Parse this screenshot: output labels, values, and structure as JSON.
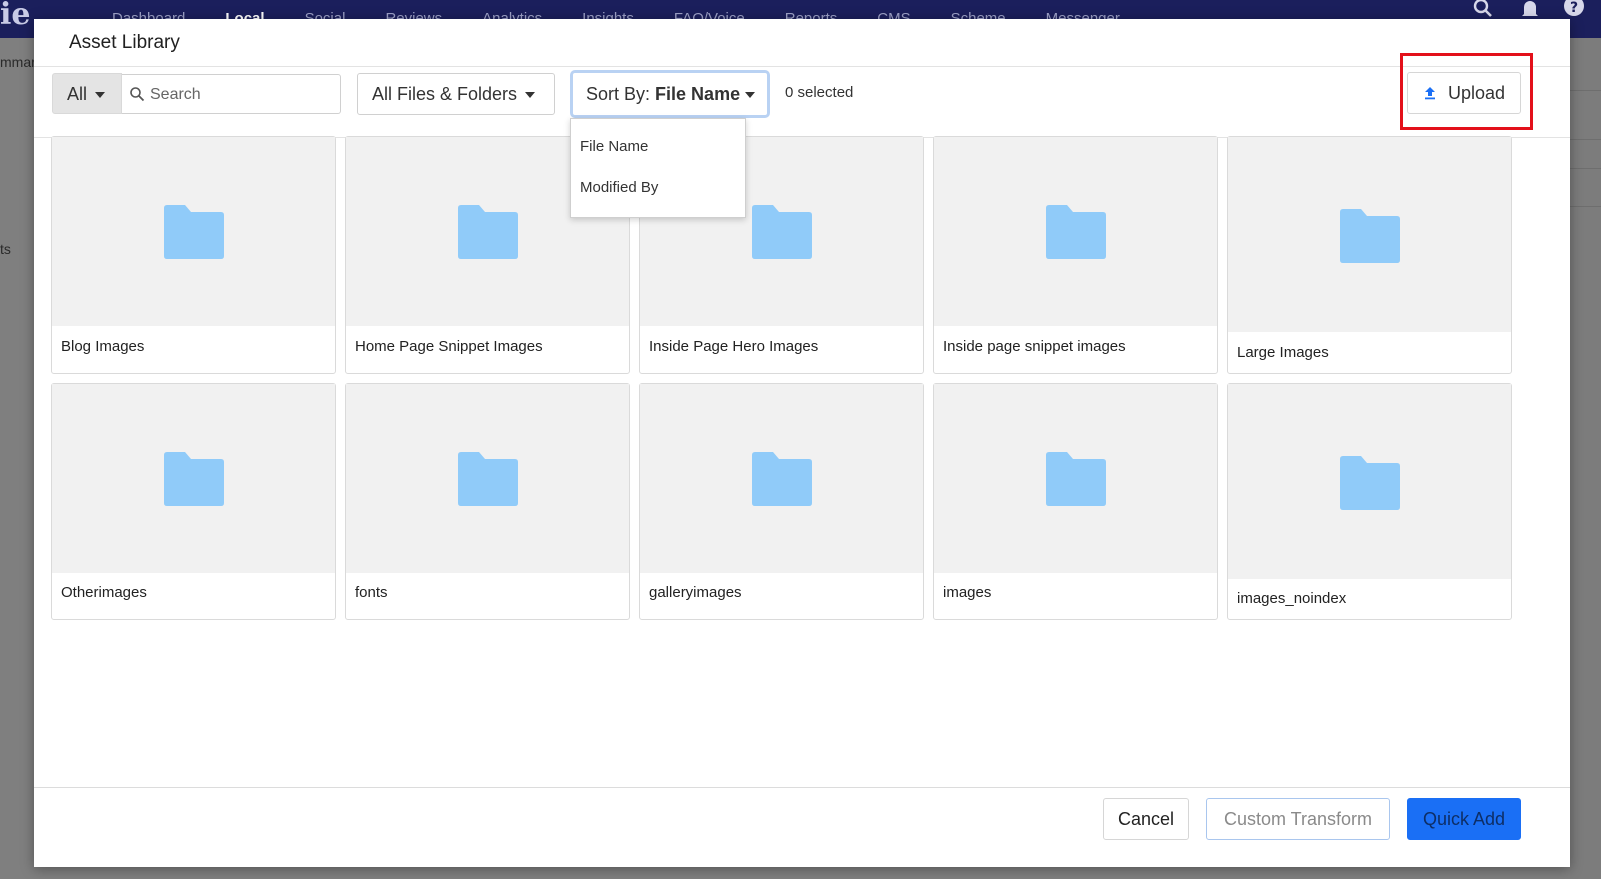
{
  "background": {
    "logo": "ie",
    "nav": [
      "Dashboard",
      "Local",
      "Social",
      "Reviews",
      "Analytics",
      "Insights",
      "FAQ/Voice",
      "Reports",
      "CMS",
      "Scheme",
      "Messenger"
    ],
    "active_nav": "Local",
    "left_fragments": [
      "mmar",
      "ts"
    ]
  },
  "modal": {
    "title": "Asset Library",
    "toolbar": {
      "type_filter": "All",
      "search_placeholder": "Search",
      "files_filter": "All Files & Folders",
      "sort_label": "Sort By:",
      "sort_value": "File Name",
      "selected_count": "0 selected",
      "upload_label": "Upload"
    },
    "sort_menu": {
      "options": [
        "File Name",
        "Modified By"
      ]
    },
    "folders": [
      "Blog Images",
      "Home Page Snippet Images",
      "Inside Page Hero Images",
      "Inside page snippet images",
      "Large Images",
      "Otherimages",
      "fonts",
      "galleryimages",
      "images",
      "images_noindex"
    ],
    "footer": {
      "cancel_label": "Cancel",
      "custom_transform_label": "Custom Transform",
      "quick_add_label": "Quick Add"
    }
  },
  "colors": {
    "nav_bg": "#1b1f5c",
    "folder": "#90cbf9",
    "primary_button": "#1a6ff5",
    "highlight": "#e3101a"
  }
}
